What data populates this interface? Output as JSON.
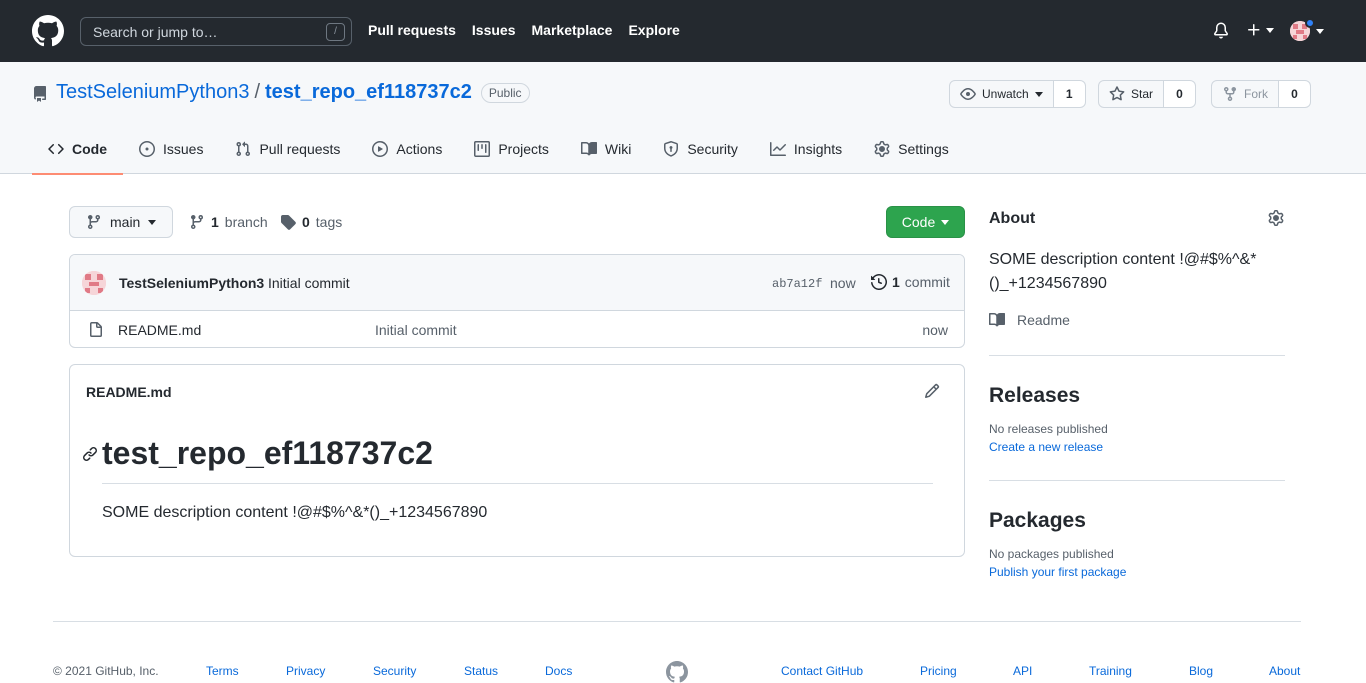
{
  "header": {
    "search_placeholder": "Search or jump to…",
    "search_shortcut": "/",
    "nav": [
      "Pull requests",
      "Issues",
      "Marketplace",
      "Explore"
    ]
  },
  "repo": {
    "owner": "TestSeleniumPython3",
    "separator": "/",
    "name": "test_repo_ef118737c2",
    "visibility": "Public",
    "watch_label": "Unwatch",
    "watch_count": "1",
    "star_label": "Star",
    "star_count": "0",
    "fork_label": "Fork",
    "fork_count": "0"
  },
  "tabs": [
    {
      "label": "Code",
      "icon": "code-icon"
    },
    {
      "label": "Issues",
      "icon": "issue-icon"
    },
    {
      "label": "Pull requests",
      "icon": "pull-request-icon"
    },
    {
      "label": "Actions",
      "icon": "play-icon"
    },
    {
      "label": "Projects",
      "icon": "project-icon"
    },
    {
      "label": "Wiki",
      "icon": "book-icon"
    },
    {
      "label": "Security",
      "icon": "shield-icon"
    },
    {
      "label": "Insights",
      "icon": "graph-icon"
    },
    {
      "label": "Settings",
      "icon": "gear-icon"
    }
  ],
  "toolbar": {
    "branch": "main",
    "branch_count": "1",
    "branch_word": "branch",
    "tag_count": "0",
    "tag_word": "tags",
    "code_button": "Code"
  },
  "latest_commit": {
    "author": "TestSeleniumPython3",
    "message": "Initial commit",
    "sha": "ab7a12f",
    "time": "now",
    "count": "1",
    "count_word": "commit"
  },
  "files": [
    {
      "name": "README.md",
      "message": "Initial commit",
      "time": "now"
    }
  ],
  "readme": {
    "filename": "README.md",
    "heading": "test_repo_ef118737c2",
    "body": "SOME description content !@#$%^&*()_+1234567890"
  },
  "about": {
    "title": "About",
    "description": "SOME description content !@#$%^&*()_+1234567890",
    "readme_label": "Readme"
  },
  "releases": {
    "title": "Releases",
    "empty": "No releases published",
    "link": "Create a new release"
  },
  "packages": {
    "title": "Packages",
    "empty": "No packages published",
    "link": "Publish your first package"
  },
  "footer": {
    "copyright": "© 2021 GitHub, Inc.",
    "left_links": [
      "Terms",
      "Privacy",
      "Security",
      "Status",
      "Docs"
    ],
    "right_links": [
      "Contact GitHub",
      "Pricing",
      "API",
      "Training",
      "Blog",
      "About"
    ]
  },
  "colors": {
    "header_bg": "#24292f",
    "link": "#0969da",
    "primary_button": "#2da44e",
    "active_tab_underline": "#fd8c73"
  }
}
